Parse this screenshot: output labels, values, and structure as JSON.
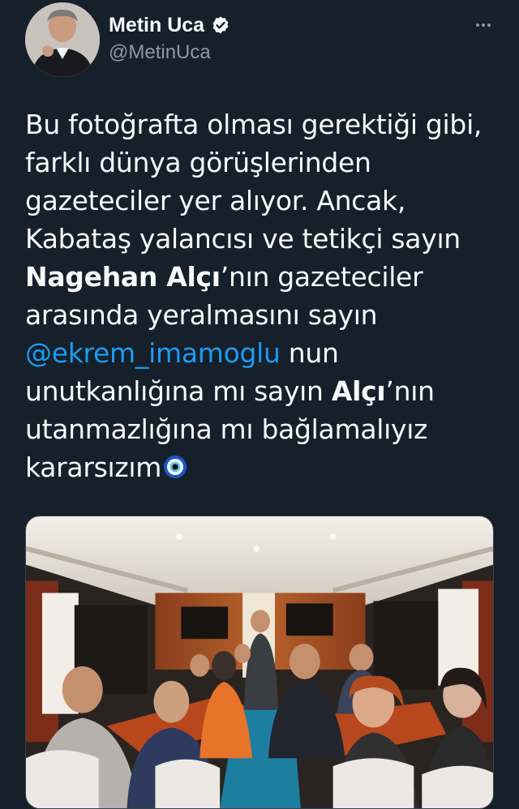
{
  "author": {
    "display_name": "Metin Uca",
    "handle": "@MetinUca",
    "verified": true,
    "avatar_icon": "profile-photo"
  },
  "menu": {
    "icon": "more-horizontal-icon"
  },
  "tweet": {
    "lines": [
      {
        "parts": [
          {
            "text": "Bu fotoğrafta olması gerektiği gibi,",
            "style": "normal"
          }
        ]
      },
      {
        "parts": [
          {
            "text": "farklı dünya görüşlerinden",
            "style": "normal"
          }
        ]
      },
      {
        "parts": [
          {
            "text": "gazeteciler yer alıyor. Ancak,",
            "style": "normal"
          }
        ]
      },
      {
        "parts": [
          {
            "text": "Kabataş yalancısı ve tetikçi sayın",
            "style": "normal"
          }
        ]
      },
      {
        "parts": [
          {
            "text": "Nagehan Alçı",
            "style": "bold"
          },
          {
            "text": "’nın gazeteciler",
            "style": "normal"
          }
        ]
      },
      {
        "parts": [
          {
            "text": "arasında yeralmasını sayın",
            "style": "normal"
          }
        ]
      },
      {
        "parts": [
          {
            "text": "@ekrem_imamoglu",
            "style": "mention"
          },
          {
            "text": " nun",
            "style": "normal"
          }
        ]
      },
      {
        "parts": [
          {
            "text": "unutkanlığına mı sayın ",
            "style": "normal"
          },
          {
            "text": "Alçı",
            "style": "bold"
          },
          {
            "text": "’nın",
            "style": "normal"
          }
        ]
      },
      {
        "parts": [
          {
            "text": "utanmazlığına mı bağlamalıyız",
            "style": "normal"
          }
        ]
      },
      {
        "parts": [
          {
            "text": "kararsızım",
            "style": "normal"
          },
          {
            "emoji": "nazar-boncugu-icon",
            "style": "emoji"
          }
        ]
      }
    ]
  },
  "media": {
    "type": "photo",
    "subject": "group-photo-inside-bus"
  },
  "colors": {
    "background": "#15202b",
    "text": "#f7f9f9",
    "secondary": "#8b98a5",
    "accent": "#1d9bf0"
  }
}
